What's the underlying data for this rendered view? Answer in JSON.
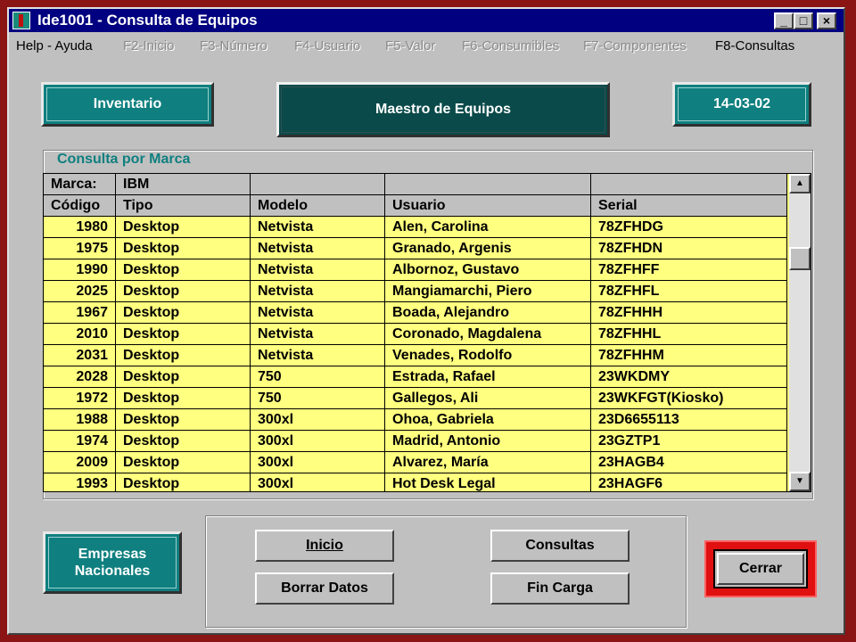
{
  "window": {
    "title": "Ide1001 - Consulta de Equipos",
    "controls": {
      "minimize": "_",
      "maximize": "□",
      "close": "×"
    }
  },
  "menu": [
    {
      "label": "Help - Ayuda",
      "enabled": true
    },
    {
      "label": "F2-Inicio",
      "enabled": false
    },
    {
      "label": "F3-Número",
      "enabled": false
    },
    {
      "label": "F4-Usuario",
      "enabled": false
    },
    {
      "label": "F5-Valor",
      "enabled": false
    },
    {
      "label": "F6-Consumibles",
      "enabled": false
    },
    {
      "label": "F7-Componentes",
      "enabled": false
    },
    {
      "label": "F8-Consultas",
      "enabled": true
    }
  ],
  "header": {
    "inventario": "Inventario",
    "maestro": "Maestro de Equipos",
    "fecha": "14-03-02"
  },
  "consulta": {
    "group_label": "Consulta por Marca",
    "marca_label": "Marca:",
    "marca_value": "IBM",
    "columns": [
      "Código",
      "Tipo",
      "Modelo",
      "Usuario",
      "Serial"
    ],
    "rows": [
      [
        "1980",
        "Desktop",
        "Netvista",
        "Alen, Carolina",
        "78ZFHDG"
      ],
      [
        "1975",
        "Desktop",
        "Netvista",
        "Granado, Argenis",
        "78ZFHDN"
      ],
      [
        "1990",
        "Desktop",
        "Netvista",
        "Albornoz, Gustavo",
        "78ZFHFF"
      ],
      [
        "2025",
        "Desktop",
        "Netvista",
        "Mangiamarchi, Piero",
        "78ZFHFL"
      ],
      [
        "1967",
        "Desktop",
        "Netvista",
        "Boada, Alejandro",
        "78ZFHHH"
      ],
      [
        "2010",
        "Desktop",
        "Netvista",
        "Coronado, Magdalena",
        "78ZFHHL"
      ],
      [
        "2031",
        "Desktop",
        "Netvista",
        "Venades, Rodolfo",
        "78ZFHHM"
      ],
      [
        "2028",
        "Desktop",
        "750",
        "Estrada, Rafael",
        "23WKDMY"
      ],
      [
        "1972",
        "Desktop",
        "750",
        "Gallegos, Ali",
        "23WKFGT(Kiosko)"
      ],
      [
        "1988",
        "Desktop",
        "300xl",
        "Ohoa, Gabriela",
        "23D6655113"
      ],
      [
        "1974",
        "Desktop",
        "300xl",
        "Madrid, Antonio",
        "23GZTP1"
      ],
      [
        "2009",
        "Desktop",
        "300xl",
        "Alvarez, María",
        "23HAGB4"
      ],
      [
        "1993",
        "Desktop",
        "300xl",
        "Hot Desk Legal",
        "23HAGF6"
      ]
    ]
  },
  "footer": {
    "empresa_line1": "Empresas",
    "empresa_line2": "Nacionales",
    "inicio": "Inicio",
    "consultas": "Consultas",
    "borrar": "Borrar Datos",
    "fin_carga": "Fin Carga",
    "cerrar": "Cerrar"
  },
  "colors": {
    "titlebar": "#000080",
    "teal": "#0f7f7f",
    "dark_teal": "#0a4a4a",
    "grid_bg": "#ffff80",
    "frame": "#8b1414",
    "cerrar_highlight": "#e01010"
  }
}
